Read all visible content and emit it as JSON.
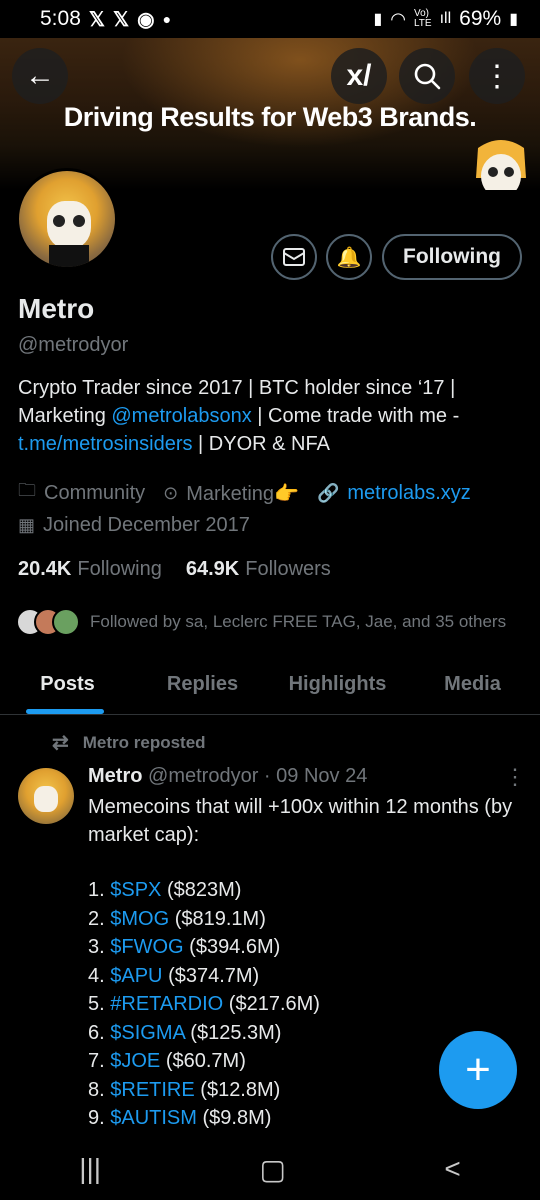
{
  "status_bar": {
    "time": "5:08",
    "battery": "69%",
    "left_icons": [
      "x-icon",
      "x-icon",
      "messenger-icon"
    ],
    "right_icons": [
      "battery-saver-icon",
      "wifi-icon",
      "volte-icon",
      "signal-icon",
      "battery-icon"
    ]
  },
  "banner": {
    "title": "Driving Results for Web3 Brands."
  },
  "header": {
    "back_icon": "back-arrow-icon",
    "brand_icon": "xai-grok-icon",
    "brand_text": "x/",
    "search_icon": "search-icon",
    "more_icon": "more-vertical-icon"
  },
  "profile": {
    "name": "Metro",
    "handle": "@metrodyor",
    "following_button": "Following",
    "bio": {
      "part1": "Crypto Trader since 2017 | BTC holder since ‘17 | Marketing ",
      "mention": "@metrolabsonx",
      "part2": " | Come trade with me - ",
      "link": "t.me/metrosinsiders",
      "part3": " | DYOR & NFA"
    },
    "category": "Community",
    "location": "Marketing👉",
    "website": "metrolabs.xyz",
    "joined": "Joined December 2017",
    "following_count": "20.4K",
    "following_label": "Following",
    "followers_count": "64.9K",
    "followers_label": "Followers",
    "followed_by": "Followed by sa, Leclerc FREE TAG, Jae, and 35 others"
  },
  "tabs": [
    {
      "label": "Posts",
      "active": true
    },
    {
      "label": "Replies",
      "active": false
    },
    {
      "label": "Highlights",
      "active": false
    },
    {
      "label": "Media",
      "active": false
    }
  ],
  "post": {
    "repost_label": "Metro reposted",
    "author_name": "Metro",
    "author_handle": "@metrodyor",
    "separator": "·",
    "date": "09 Nov 24",
    "text": "Memecoins that will +100x within 12 months (by market cap):",
    "list": [
      {
        "num": "1.",
        "tag": "$SPX",
        "value": "($823M)"
      },
      {
        "num": "2.",
        "tag": "$MOG",
        "value": "($819.1M)"
      },
      {
        "num": "3.",
        "tag": "$FWOG",
        "value": "($394.6M)"
      },
      {
        "num": "4.",
        "tag": "$APU",
        "value": "($374.7M)"
      },
      {
        "num": "5.",
        "tag": "#RETARDIO",
        "value": "($217.6M)"
      },
      {
        "num": "6.",
        "tag": "$SIGMA",
        "value": "($125.3M)"
      },
      {
        "num": "7.",
        "tag": "$JOE",
        "value": "($60.7M)"
      },
      {
        "num": "8.",
        "tag": "$RETIRE",
        "value": "($12.8M)"
      },
      {
        "num": "9.",
        "tag": "$AUTISM",
        "value": "($9.8M)"
      }
    ]
  },
  "colors": {
    "accent": "#1d9bf0",
    "text_primary": "#e7e9ea",
    "text_secondary": "#71767b",
    "background": "#000000"
  }
}
